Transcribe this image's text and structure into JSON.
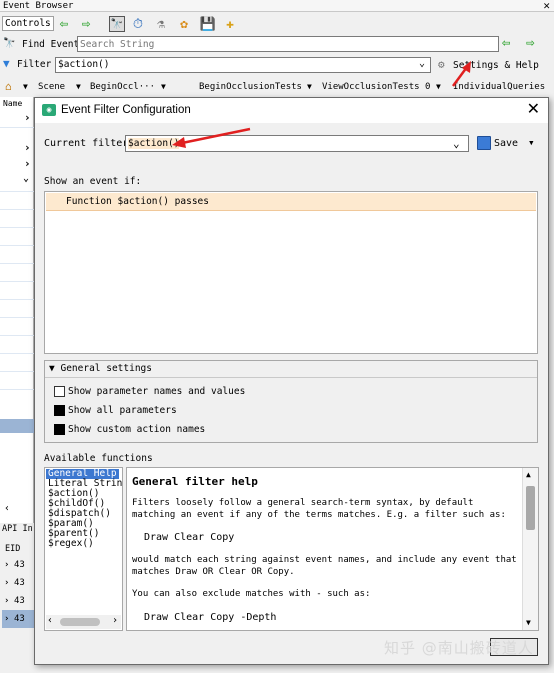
{
  "event_browser": {
    "title": "Event Browser",
    "close": "✕",
    "controls_label": "Controls",
    "find_label": "Find Event",
    "find_placeholder": "Search String",
    "filter_label": "Filter",
    "filter_value": "$action()",
    "settings_label": "Settings & Help",
    "tree_items": [
      "Scene",
      "BeginOccl···",
      "BeginOcclusionTests",
      "ViewOcclusionTests 0",
      "IndividualQueries"
    ],
    "name_header": "Name",
    "api_label": "API In",
    "eid_header": "EID",
    "api_rows": [
      "43",
      "43",
      "43",
      "43"
    ]
  },
  "dialog": {
    "title": "Event Filter Configuration",
    "close": "✕",
    "current_filter_label": "Current filter:",
    "current_filter_value": "$action()",
    "save_label": "Save",
    "show_event_if": "Show an event if:",
    "condition": "Function $action() passes",
    "general_settings": {
      "header": "General settings",
      "options": [
        {
          "label": "Show parameter names and values",
          "checked": false
        },
        {
          "label": "Show all parameters",
          "checked": true
        },
        {
          "label": "Show custom action names",
          "checked": true
        }
      ]
    },
    "available_functions_label": "Available functions",
    "functions": [
      "General Help",
      "Literal String",
      "$action()",
      "$childOf()",
      "$dispatch()",
      "$param()",
      "$parent()",
      "$regex()"
    ],
    "help": {
      "title": "General filter help",
      "p1": "Filters loosely follow a general search-term syntax, by default matching an event if any of the terms matches. E.g. a filter such as:",
      "code1": "Draw Clear Copy",
      "p2": "would match each string against event names, and include any event that matches Draw OR Clear OR Copy.",
      "p3": "You can also exclude matches with - such as:",
      "code2": "Draw Clear Copy -Depth"
    }
  },
  "watermark": "知乎 @南山搬砖道人",
  "colors": {
    "condition_bg": "#fde9cf",
    "selected_fn": "#3d78d0",
    "annotation_arrow": "#e02020"
  }
}
